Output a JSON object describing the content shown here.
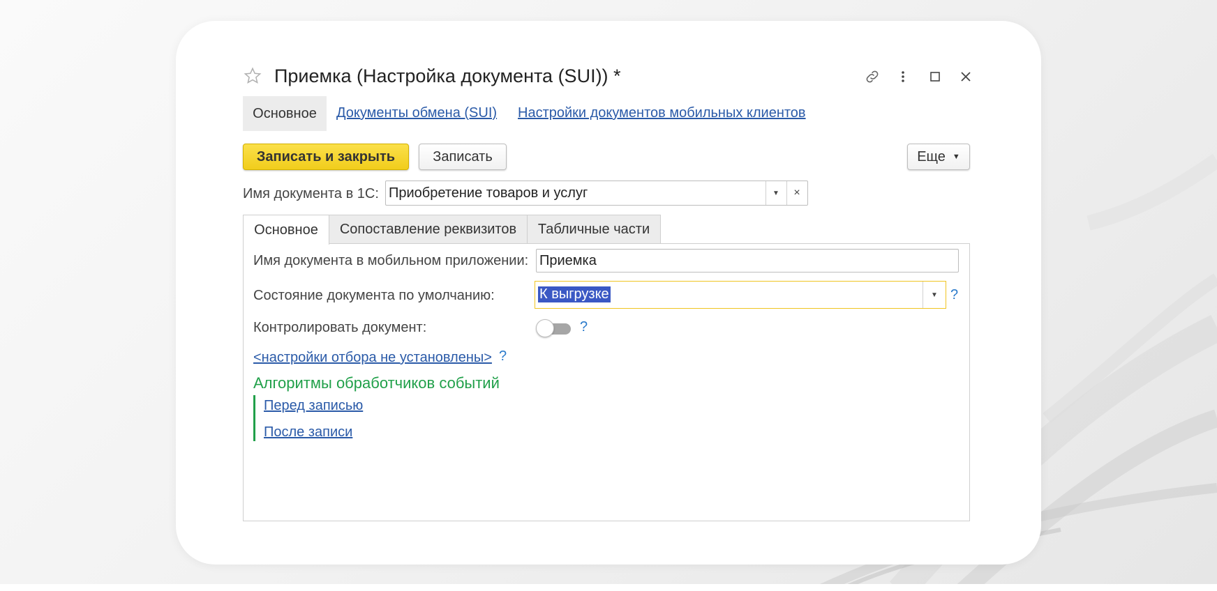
{
  "window": {
    "title": "Приемка (Настройка документа (SUI)) *"
  },
  "nav": {
    "active": "Основное",
    "links": [
      "Документы обмена (SUI)",
      "Настройки документов мобильных клиентов"
    ]
  },
  "toolbar": {
    "save_close_label": "Записать и закрыть",
    "save_label": "Записать",
    "more_label": "Еще"
  },
  "header_field": {
    "label": "Имя документа в 1С:",
    "value": "Приобретение товаров и услуг"
  },
  "tabs": [
    "Основное",
    "Сопоставление реквизитов",
    "Табличные части"
  ],
  "form": {
    "mobile_name_label": "Имя документа в мобильном приложении:",
    "mobile_name_value": "Приемка",
    "default_state_label": "Состояние документа по умолчанию:",
    "default_state_value": "К выгрузке",
    "control_label": "Контролировать документ:",
    "control_on": false,
    "filter_link": "<настройки отбора не установлены>",
    "help_mark": "?"
  },
  "handlers": {
    "title": "Алгоритмы обработчиков событий",
    "before_write": "Перед записью",
    "after_write": "После записи"
  },
  "colors": {
    "primary_button": "#f3d02b",
    "link": "#2a5aa8",
    "group_accent": "#21a04a",
    "selection": "#3a58c4",
    "focus_border": "#f0c420"
  }
}
